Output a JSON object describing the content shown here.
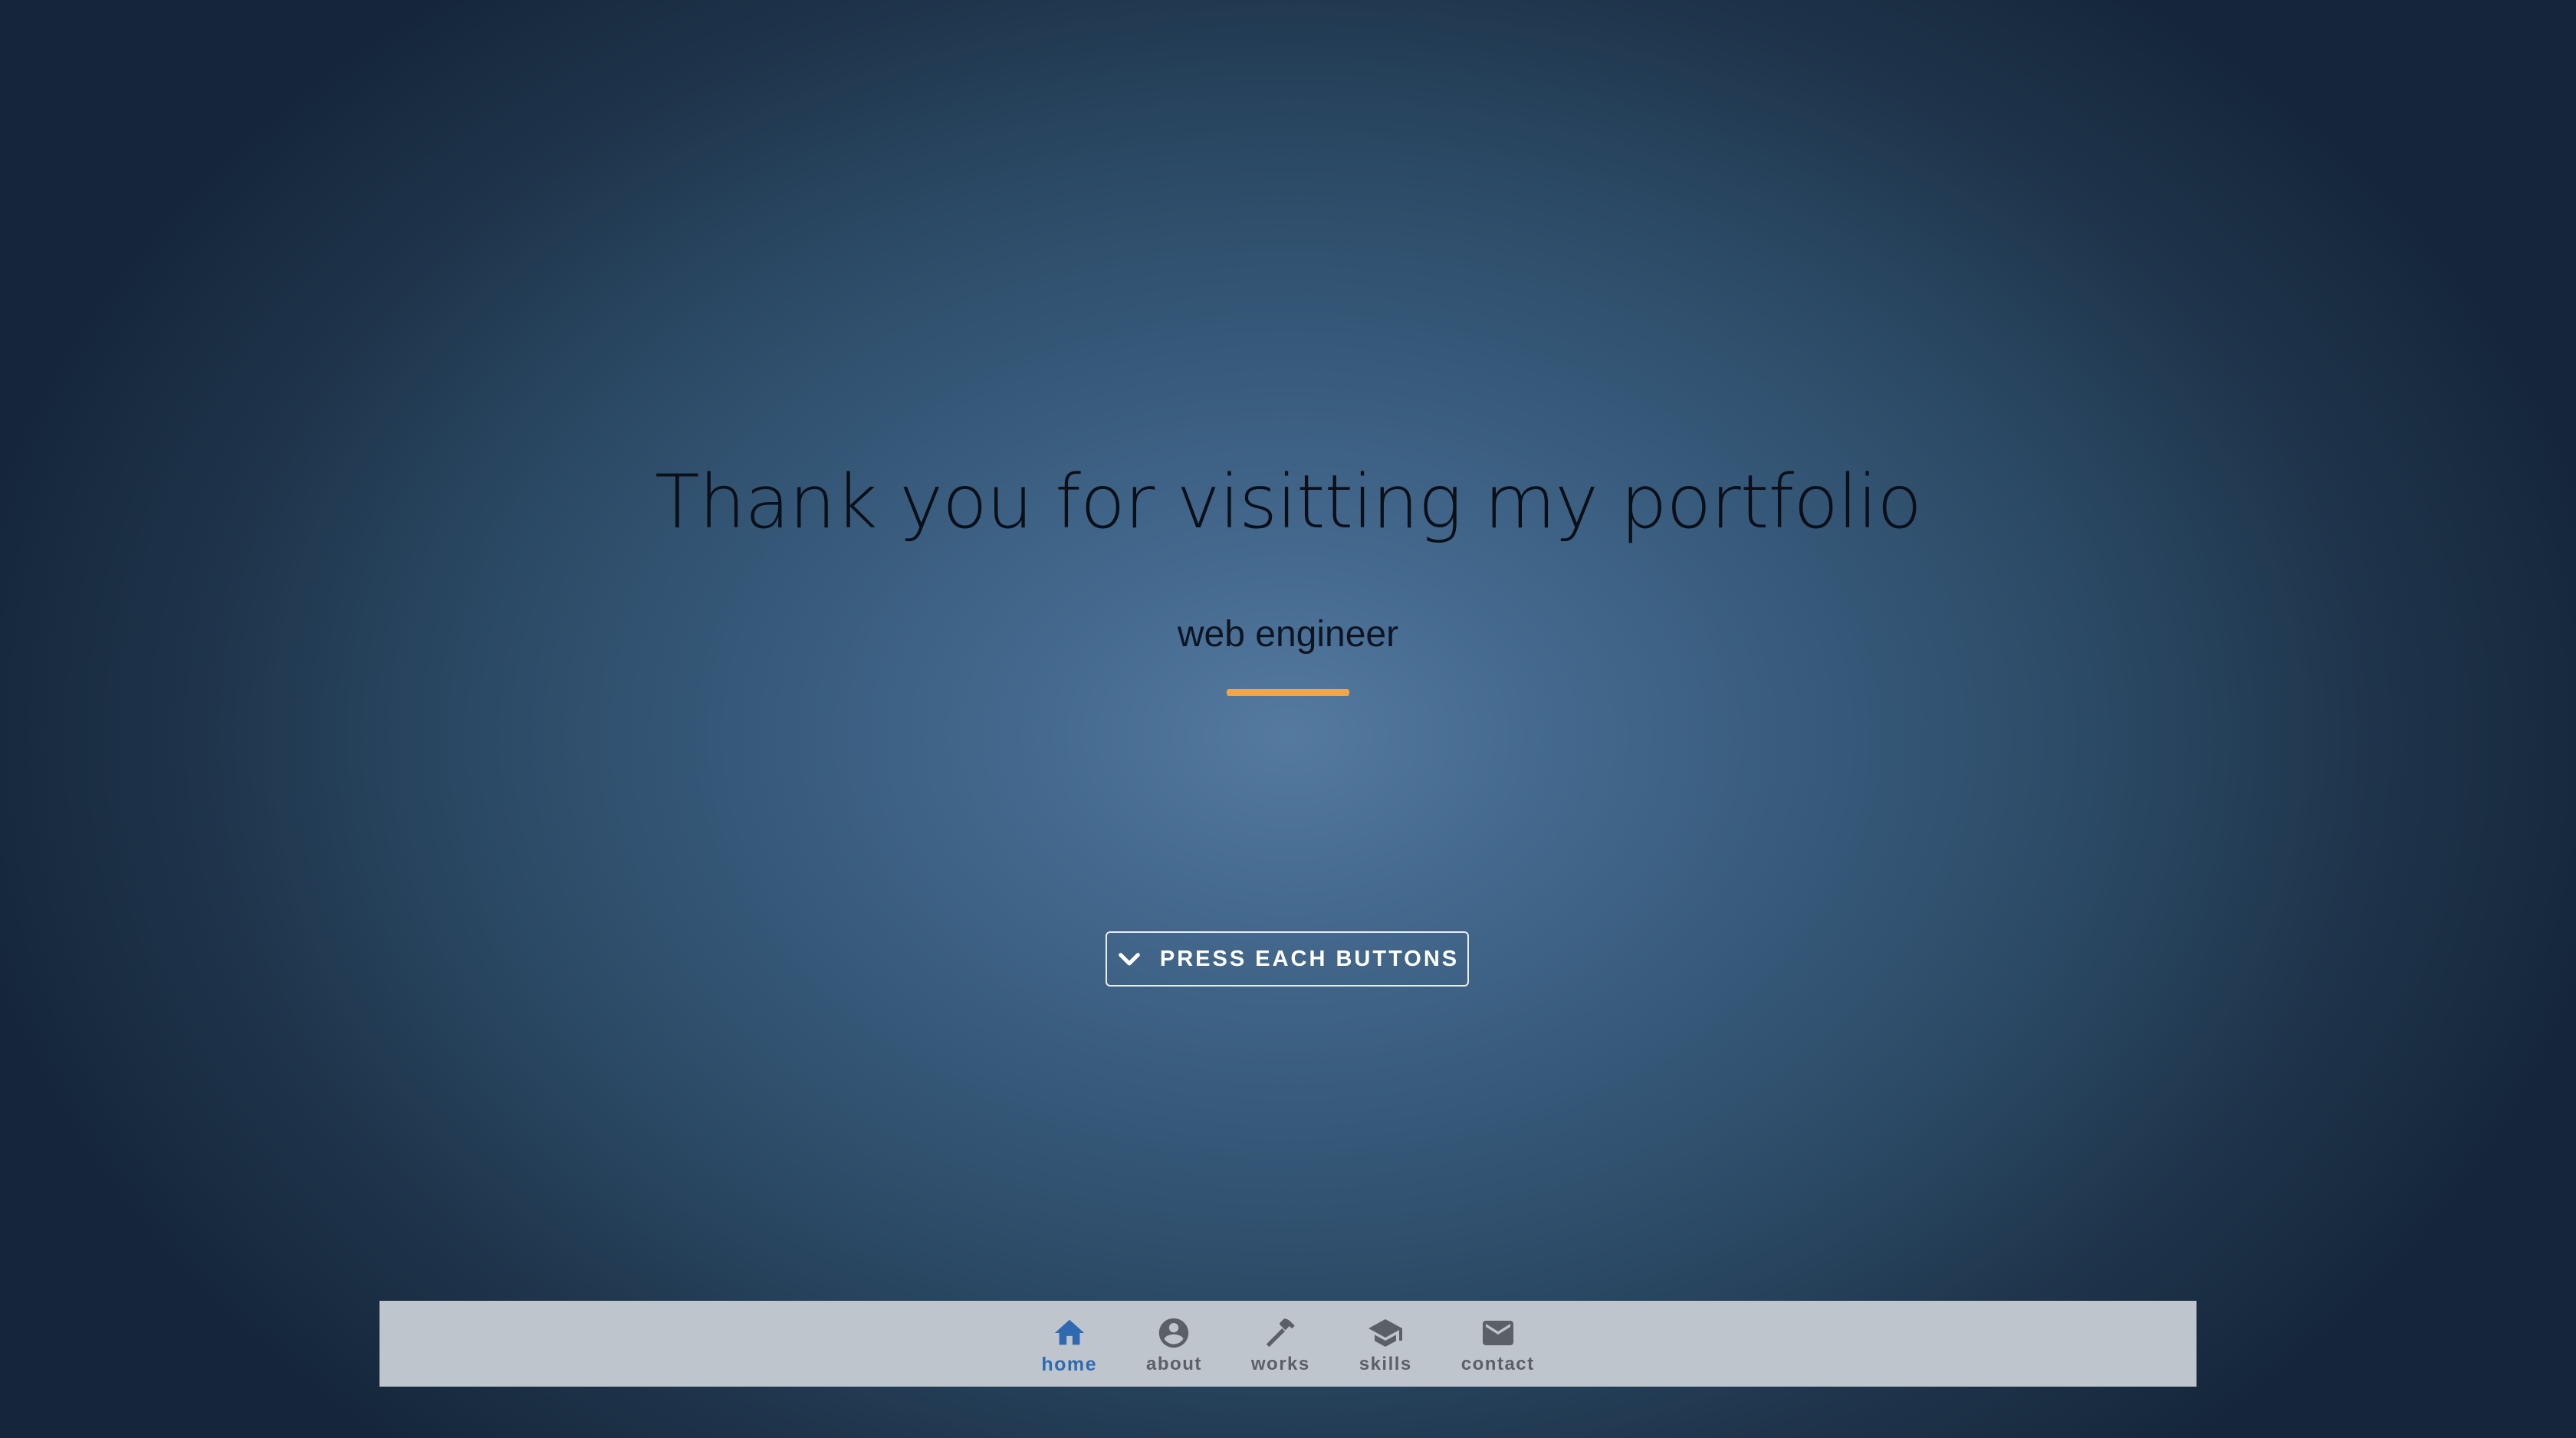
{
  "hero": {
    "title": "Thank you for visitting my portfolio",
    "subtitle": "web engineer",
    "accent_color": "#f0a54a"
  },
  "cta": {
    "icon": "chevron-down-icon",
    "label": "PRESS EACH BUTTONS"
  },
  "bottom_nav": {
    "active_color": "#2f6ab0",
    "inactive_color": "#5b6066",
    "items": [
      {
        "label": "home",
        "icon": "home-icon",
        "active": true
      },
      {
        "label": "about",
        "icon": "account-circle-icon",
        "active": false
      },
      {
        "label": "works",
        "icon": "hammer-icon",
        "active": false
      },
      {
        "label": "skills",
        "icon": "graduation-cap-icon",
        "active": false
      },
      {
        "label": "contact",
        "icon": "mail-icon",
        "active": false
      }
    ]
  }
}
